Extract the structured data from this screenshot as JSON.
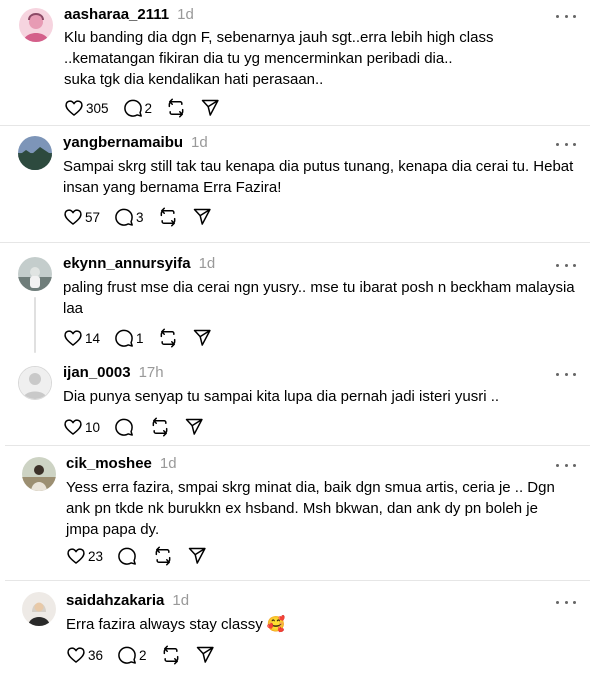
{
  "posts": [
    {
      "username": "aasharaa_2111",
      "time": "1d",
      "text": "Klu banding dia dgn F, sebenarnya jauh sgt..erra lebih high class ..kematangan fikiran dia tu yg mencerminkan peribadi dia..\nsuka tgk dia kendalikan hati perasaan..",
      "likes": "305",
      "replies": "2",
      "avatar_color": "#f0b6c8"
    },
    {
      "username": "yangbernamaibu",
      "time": "1d",
      "text": "Sampai skrg still tak tau kenapa dia putus tunang, kenapa dia cerai tu. Hebat insan yang bernama Erra Fazira!",
      "likes": "57",
      "replies": "3",
      "avatar_color": "#5b7090"
    },
    {
      "username": "ekynn_annursyifa",
      "time": "1d",
      "text": "paling frust mse dia cerai ngn yusry.. mse tu ibarat posh n beckham malaysia laa",
      "likes": "14",
      "replies": "1",
      "avatar_color": "#9aa7a5"
    },
    {
      "username": "ijan_0003",
      "time": "17h",
      "text": "Dia punya senyap tu sampai kita lupa dia pernah jadi isteri yusri ..",
      "likes": "10",
      "replies": "",
      "avatar_color": "#e4e4e4"
    },
    {
      "username": "cik_moshee",
      "time": "1d",
      "text": "Yess erra fazira, smpai skrg minat dia, baik dgn smua artis, ceria je .. Dgn ank pn tkde nk burukkn ex hsband. Msh bkwan, dan ank dy pn boleh je jmpa papa dy.",
      "likes": "23",
      "replies": "",
      "avatar_color": "#b9a98c"
    },
    {
      "username": "saidahzakaria",
      "time": "1d",
      "text": "Erra fazira always stay classy 🥰",
      "likes": "36",
      "replies": "2",
      "avatar_color": "#d9d6d2"
    }
  ]
}
